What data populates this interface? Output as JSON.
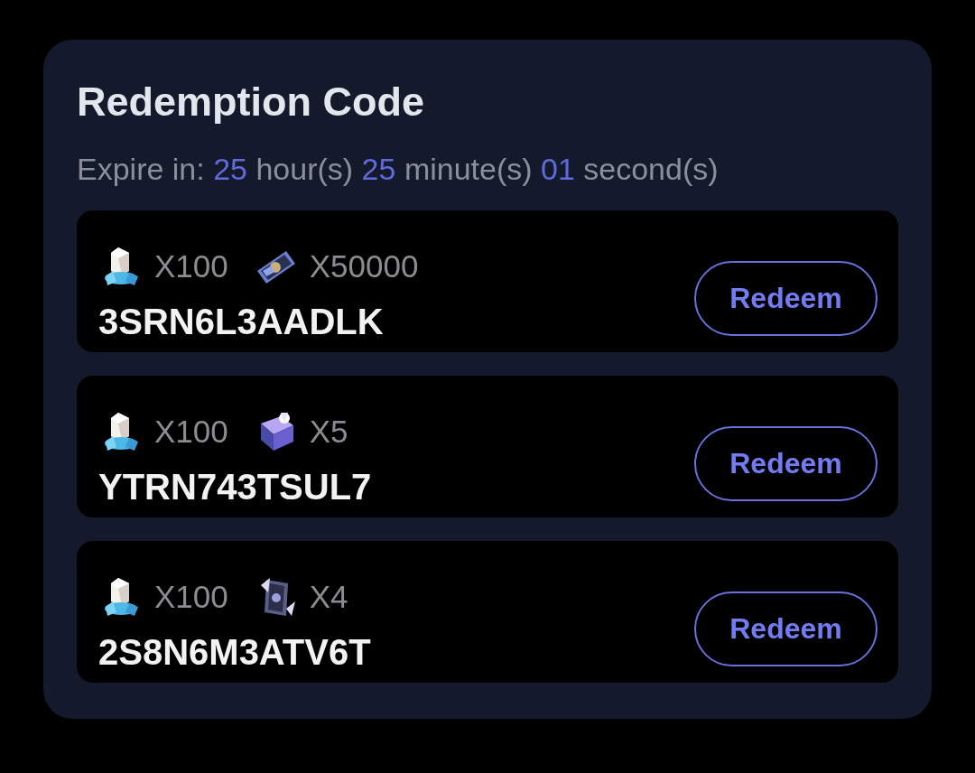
{
  "title": "Redemption Code",
  "countdown": {
    "label": "Expire in:",
    "parts": [
      {
        "value": "25",
        "unit": "hour(s)"
      },
      {
        "value": "25",
        "unit": "minute(s)"
      },
      {
        "value": "01",
        "unit": "second(s)"
      }
    ]
  },
  "codes": [
    {
      "rewards": [
        {
          "kind": "crystal",
          "amount": "X100"
        },
        {
          "kind": "ticket",
          "amount": "X50000"
        }
      ],
      "code": "3SRN6L3AADLK",
      "button": "Redeem"
    },
    {
      "rewards": [
        {
          "kind": "crystal",
          "amount": "X100"
        },
        {
          "kind": "box",
          "amount": "X5"
        }
      ],
      "code": "YTRN743TSUL7",
      "button": "Redeem"
    },
    {
      "rewards": [
        {
          "kind": "crystal",
          "amount": "X100"
        },
        {
          "kind": "card",
          "amount": "X4"
        }
      ],
      "code": "2S8N6M3ATV6T",
      "button": "Redeem"
    }
  ]
}
